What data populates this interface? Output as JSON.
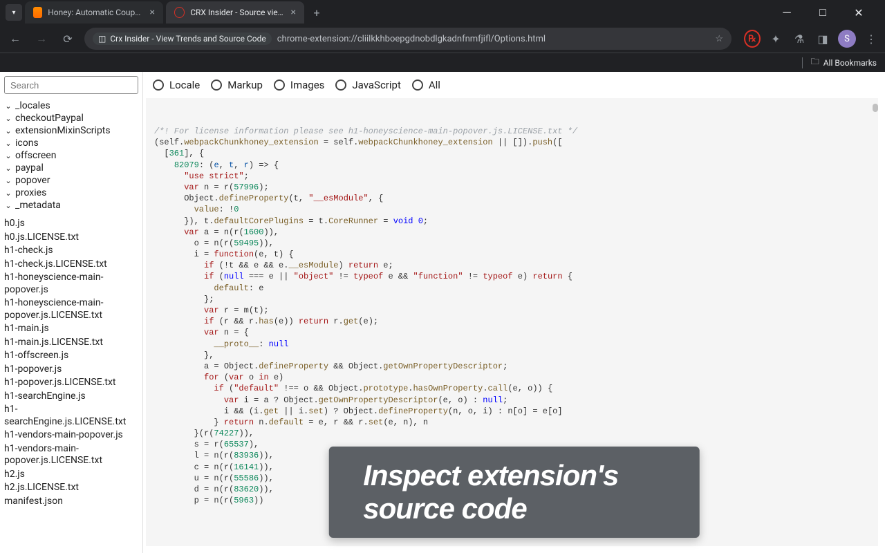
{
  "tabs": [
    {
      "title": "Honey: Automatic Coupons & ...",
      "active": false
    },
    {
      "title": "CRX Insider - Source viewer",
      "active": true
    }
  ],
  "address": {
    "chip": "Crx Insider - View Trends and Source Code",
    "url": "chrome-extension://cliilkkhboepgdnobdlgkadnfnmfjifl/Options.html"
  },
  "avatar_initial": "S",
  "bookmarks_label": "All Bookmarks",
  "search_placeholder": "Search",
  "folders": [
    "_locales",
    "checkoutPaypal",
    "extensionMixinScripts",
    "icons",
    "offscreen",
    "paypal",
    "popover",
    "proxies",
    "_metadata"
  ],
  "files": [
    "h0.js",
    "h0.js.LICENSE.txt",
    "h1-check.js",
    "h1-check.js.LICENSE.txt",
    "h1-honeyscience-main-popover.js",
    "h1-honeyscience-main-popover.js.LICENSE.txt",
    "h1-main.js",
    "h1-main.js.LICENSE.txt",
    "h1-offscreen.js",
    "h1-popover.js",
    "h1-popover.js.LICENSE.txt",
    "h1-searchEngine.js",
    "h1-searchEngine.js.LICENSE.txt",
    "h1-vendors-main-popover.js",
    "h1-vendors-main-popover.js.LICENSE.txt",
    "h2.js",
    "h2.js.LICENSE.txt",
    "manifest.json"
  ],
  "filters": [
    "Locale",
    "Markup",
    "Images",
    "JavaScript",
    "All"
  ],
  "banner_text": "Inspect extension's source code",
  "code": {
    "comment": "/*! For license information please see h1-honeyscience-main-popover.js.LICENSE.txt */",
    "l1a": "(self.",
    "l1b": "webpackChunkhoney_extension",
    "l1c": " = self.",
    "l1d": "webpackChunkhoney_extension",
    "l1e": " || []).",
    "l1f": "push",
    "l1g": "([",
    "l2a": "[",
    "l2b": "361",
    "l2c": "], {",
    "l3a": "82079",
    "l3b": ": (",
    "l3c": "e",
    "l3d": ", ",
    "l3e": "t",
    "l3f": ", ",
    "l3g": "r",
    "l3h": ") => {",
    "l4": "\"use strict\"",
    "l4b": ";",
    "l5a": "var",
    "l5b": " n = r(",
    "l5c": "57996",
    "l5d": ");",
    "l6a": "Object.",
    "l6b": "defineProperty",
    "l6c": "(t, ",
    "l6d": "\"__esModule\"",
    "l6e": ", {",
    "l7a": "value",
    "l7b": ": !",
    "l7c": "0",
    "l8a": "}), t.",
    "l8b": "defaultCorePlugins",
    "l8c": " = t.",
    "l8d": "CoreRunner",
    "l8e": " = ",
    "l8f": "void 0",
    "l8g": ";",
    "l9a": "var",
    "l9b": " a = n(r(",
    "l9c": "1600",
    "l9d": ")),",
    "l10a": "o = n(r(",
    "l10b": "59495",
    "l10c": ")),",
    "l11a": "i = ",
    "l11b": "function",
    "l11c": "(e, t) {",
    "l12a": "if",
    "l12b": " (!t && e && e.",
    "l12c": "__esModule",
    "l12d": ") ",
    "l12e": "return",
    "l12f": " e;",
    "l13a": "if",
    "l13b": " (",
    "l13c": "null",
    "l13d": " === e || ",
    "l13e": "\"object\"",
    "l13f": " != ",
    "l13g": "typeof",
    "l13h": " e && ",
    "l13i": "\"function\"",
    "l13j": " != ",
    "l13k": "typeof",
    "l13l": " e) ",
    "l13m": "return",
    "l13n": " {",
    "l14a": "default",
    "l14b": ": e",
    "l15": "};",
    "l16a": "var",
    "l16b": " r = m(t);",
    "l17a": "if",
    "l17b": " (r && r.",
    "l17c": "has",
    "l17d": "(e)) ",
    "l17e": "return",
    "l17f": " r.",
    "l17g": "get",
    "l17h": "(e);",
    "l18a": "var",
    "l18b": " n = {",
    "l19a": "__proto__",
    "l19b": ": ",
    "l19c": "null",
    "l20": "},",
    "l21a": "a = Object.",
    "l21b": "defineProperty",
    "l21c": " && Object.",
    "l21d": "getOwnPropertyDescriptor",
    "l21e": ";",
    "l22a": "for",
    "l22b": " (",
    "l22c": "var",
    "l22d": " o ",
    "l22e": "in",
    "l22f": " e)",
    "l23a": "if",
    "l23b": " (",
    "l23c": "\"default\"",
    "l23d": " !== o && Object.",
    "l23e": "prototype",
    "l23f": ".",
    "l23g": "hasOwnProperty",
    "l23h": ".",
    "l23i": "call",
    "l23j": "(e, o)) {",
    "l24a": "var",
    "l24b": " i = a ? Object.",
    "l24c": "getOwnPropertyDescriptor",
    "l24d": "(e, o) : ",
    "l24e": "null",
    "l24f": ";",
    "l25a": "i && (i.",
    "l25b": "get",
    "l25c": " || i.",
    "l25d": "set",
    "l25e": ") ? Object.",
    "l25f": "defineProperty",
    "l25g": "(n, o, i) : n[o] = e[o]",
    "l26a": "} ",
    "l26b": "return",
    "l26c": " n.",
    "l26d": "default",
    "l26e": " = e, r && r.",
    "l26f": "set",
    "l26g": "(e, n), n",
    "l27a": "}(r(",
    "l27b": "74227",
    "l27c": ")),",
    "l28a": "s = r(",
    "l28b": "65537",
    "l28c": "),",
    "l29a": "l = n(r(",
    "l29b": "83936",
    "l29c": ")),",
    "l30a": "c = n(r(",
    "l30b": "16141",
    "l30c": ")),",
    "l31a": "u = n(r(",
    "l31b": "55586",
    "l31c": ")),",
    "l32a": "d = n(r(",
    "l32b": "83620",
    "l32c": ")),",
    "l33a": "p = n(r(",
    "l33b": "5963",
    "l33c": "))"
  }
}
